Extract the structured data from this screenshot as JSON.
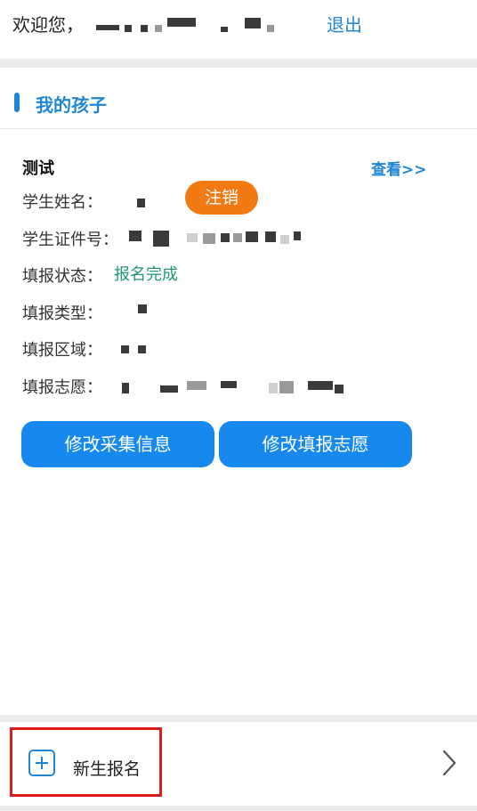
{
  "header": {
    "welcome": "欢迎您，",
    "logout": "退出"
  },
  "section": {
    "title": "我的孩子"
  },
  "child": {
    "name": "测试",
    "view_more": "查看>>",
    "cancel_label": "注销",
    "fields": {
      "student_name_label": "学生姓名：",
      "student_id_label": "学生证件号：",
      "status_label": "填报状态：",
      "status_value": "报名完成",
      "type_label": "填报类型：",
      "area_label": "填报区域：",
      "wish_label": "填报志愿："
    },
    "buttons": {
      "edit_info": "修改采集信息",
      "edit_wish": "修改填报志愿"
    }
  },
  "footer": {
    "new_registration": "新生报名",
    "icons": [
      "plus-icon",
      "chevron-right-icon"
    ]
  },
  "colors": {
    "accent": "#1f86d6",
    "button": "#1789ee",
    "cancel": "#f27a12",
    "status": "#1e9a6e",
    "highlight": "#e0191b"
  }
}
